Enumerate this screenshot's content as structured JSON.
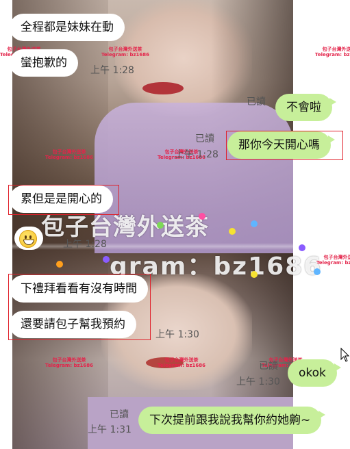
{
  "chat": {
    "messages": [
      {
        "side": "in",
        "text": "全程都是妹妹在動"
      },
      {
        "side": "in",
        "text": "蠻抱歉的",
        "time": "上午 1:28"
      },
      {
        "side": "out",
        "text": "不會啦",
        "read": "已讀"
      },
      {
        "side": "out",
        "text": "那你今天開心嗎",
        "read": "已讀",
        "time": "上午 1:28"
      },
      {
        "side": "in",
        "text": "累但是是開心的"
      },
      {
        "side": "in",
        "emoji": "grinning-face-icon",
        "time": "上午 1:28"
      },
      {
        "side": "in",
        "text": "下禮拜看看有沒有時間"
      },
      {
        "side": "in",
        "text": "還要請包子幫我預約",
        "time": "上午 1:30"
      },
      {
        "side": "out",
        "text": "okok",
        "read": "已讀",
        "time": "上午 1:30"
      },
      {
        "side": "out",
        "text": "下次提前跟我說我幫你約她齁~",
        "read": "已讀",
        "time": "上午 1:31"
      }
    ]
  },
  "watermark": {
    "title": "包子台灣外送茶",
    "handle": "gram：bz1686",
    "small_line1": "包子台灣外送茶",
    "small_line2": "Telegram: bz1686"
  },
  "colors": {
    "outgoing_bubble": "#c7ef9a",
    "incoming_bubble": "#ffffff",
    "highlight_border": "#e0202a",
    "meta_text": "#555555"
  }
}
